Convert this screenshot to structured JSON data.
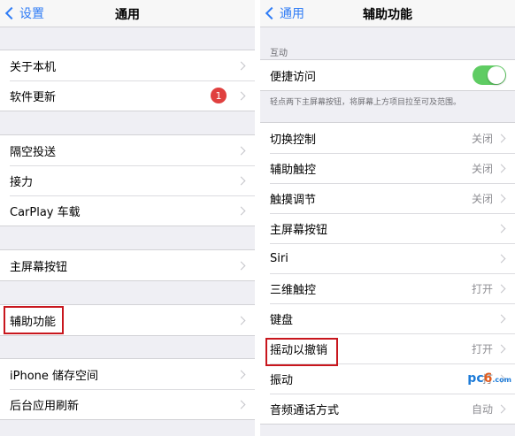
{
  "left": {
    "nav": {
      "back": "设置",
      "title": "通用"
    },
    "group1": [
      {
        "label": "关于本机"
      },
      {
        "label": "软件更新",
        "badge": "1"
      }
    ],
    "group2": [
      {
        "label": "隔空投送"
      },
      {
        "label": "接力"
      },
      {
        "label": "CarPlay 车载"
      }
    ],
    "group3": [
      {
        "label": "主屏幕按钮"
      }
    ],
    "group4": [
      {
        "label": "辅助功能"
      }
    ],
    "group5": [
      {
        "label": "iPhone 储存空间"
      },
      {
        "label": "后台应用刷新"
      }
    ]
  },
  "right": {
    "nav": {
      "back": "通用",
      "title": "辅助功能"
    },
    "section_header": "互动",
    "toggle_row": {
      "label": "便捷访问"
    },
    "footer_note": "轻点两下主屏幕按钮，将屏幕上方项目拉至可及范围。",
    "items": [
      {
        "label": "切换控制",
        "value": "关闭"
      },
      {
        "label": "辅助触控",
        "value": "关闭"
      },
      {
        "label": "触摸调节",
        "value": "关闭"
      },
      {
        "label": "主屏幕按钮",
        "value": ""
      },
      {
        "label": "Siri",
        "value": ""
      },
      {
        "label": "三维触控",
        "value": "打开"
      },
      {
        "label": "键盘",
        "value": ""
      },
      {
        "label": "摇动以撤销",
        "value": "打开"
      },
      {
        "label": "振动",
        "value": "打"
      },
      {
        "label": "音频通话方式",
        "value": "自动"
      }
    ]
  },
  "watermark": {
    "pre": "pc",
    "six": "6",
    "suffix": ".com"
  },
  "colors": {
    "accent": "#2f7cf6",
    "highlight": "#c8161d",
    "toggle_on": "#5fcc63",
    "badge": "#e0403f"
  }
}
